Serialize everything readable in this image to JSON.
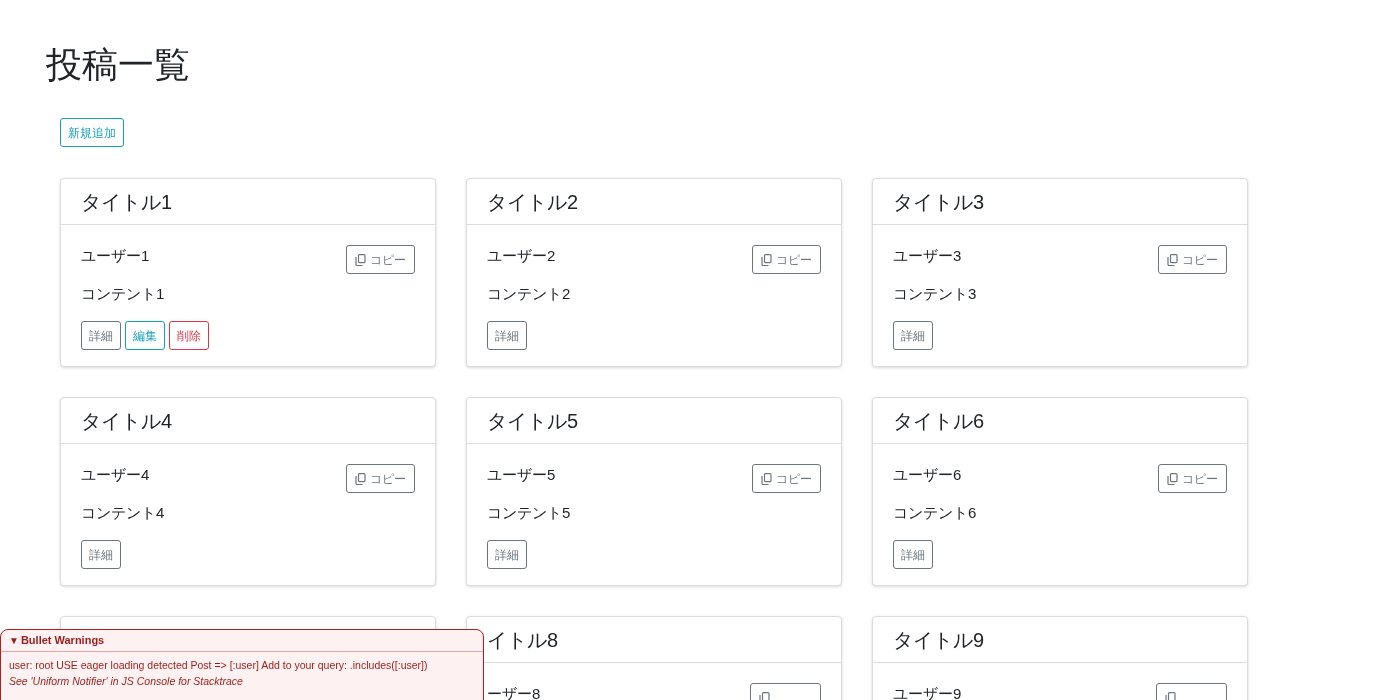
{
  "page_title": "投稿一覧",
  "new_button": "新規追加",
  "posts": [
    {
      "title": "タイトル1",
      "user": "ユーザー1",
      "content": "コンテント1",
      "copy": "コピー",
      "actions": [
        {
          "label": "詳細",
          "kind": "detail"
        },
        {
          "label": "編集",
          "kind": "edit"
        },
        {
          "label": "削除",
          "kind": "delete"
        }
      ]
    },
    {
      "title": "タイトル2",
      "user": "ユーザー2",
      "content": "コンテント2",
      "copy": "コピー",
      "actions": [
        {
          "label": "詳細",
          "kind": "detail"
        }
      ]
    },
    {
      "title": "タイトル3",
      "user": "ユーザー3",
      "content": "コンテント3",
      "copy": "コピー",
      "actions": [
        {
          "label": "詳細",
          "kind": "detail"
        }
      ]
    },
    {
      "title": "タイトル4",
      "user": "ユーザー4",
      "content": "コンテント4",
      "copy": "コピー",
      "actions": [
        {
          "label": "詳細",
          "kind": "detail"
        }
      ]
    },
    {
      "title": "タイトル5",
      "user": "ユーザー5",
      "content": "コンテント5",
      "copy": "コピー",
      "actions": [
        {
          "label": "詳細",
          "kind": "detail"
        }
      ]
    },
    {
      "title": "タイトル6",
      "user": "ユーザー6",
      "content": "コンテント6",
      "copy": "コピー",
      "actions": [
        {
          "label": "詳細",
          "kind": "detail"
        }
      ]
    },
    {
      "kind": "covered"
    },
    {
      "kind": "cut",
      "title": "イトル8",
      "user": "ーザー8"
    },
    {
      "kind": "cut",
      "title": "タイトル9",
      "user": "ユーザー9"
    }
  ],
  "warning": {
    "toggle": "▼",
    "title": "Bullet Warnings",
    "message": "user: root USE eager loading detected Post => [:user] Add to your query: .includes([:user])",
    "note": "See 'Uniform Notifier' in JS Console for Stacktrace"
  }
}
